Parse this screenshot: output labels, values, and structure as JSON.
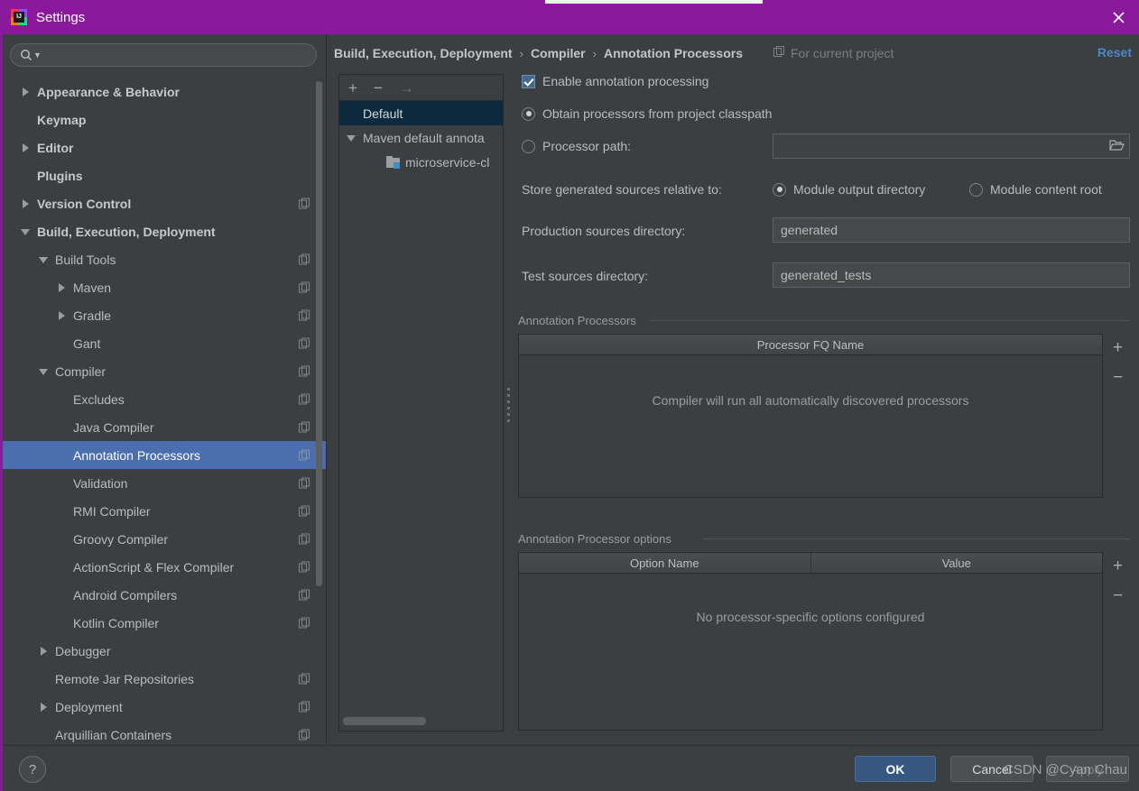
{
  "window": {
    "title": "Settings",
    "logo_icon": "intellij-idea-logo",
    "close_icon": "close-icon"
  },
  "sidebar": {
    "search": {
      "placeholder": "",
      "value": "",
      "icon": "search-icon",
      "dropdown_icon": "chevron-down-icon"
    },
    "items": [
      {
        "label": "Appearance & Behavior",
        "indent": 0,
        "twisty": "right",
        "bold": true,
        "copy": false,
        "selected": false
      },
      {
        "label": "Keymap",
        "indent": 0,
        "twisty": "none",
        "bold": true,
        "copy": false,
        "selected": false
      },
      {
        "label": "Editor",
        "indent": 0,
        "twisty": "right",
        "bold": true,
        "copy": false,
        "selected": false
      },
      {
        "label": "Plugins",
        "indent": 0,
        "twisty": "none",
        "bold": true,
        "copy": false,
        "selected": false
      },
      {
        "label": "Version Control",
        "indent": 0,
        "twisty": "right",
        "bold": true,
        "copy": true,
        "selected": false
      },
      {
        "label": "Build, Execution, Deployment",
        "indent": 0,
        "twisty": "down",
        "bold": true,
        "copy": false,
        "selected": false
      },
      {
        "label": "Build Tools",
        "indent": 1,
        "twisty": "down",
        "bold": false,
        "copy": true,
        "selected": false
      },
      {
        "label": "Maven",
        "indent": 2,
        "twisty": "right",
        "bold": false,
        "copy": true,
        "selected": false
      },
      {
        "label": "Gradle",
        "indent": 2,
        "twisty": "right",
        "bold": false,
        "copy": true,
        "selected": false
      },
      {
        "label": "Gant",
        "indent": 2,
        "twisty": "none",
        "bold": false,
        "copy": true,
        "selected": false
      },
      {
        "label": "Compiler",
        "indent": 1,
        "twisty": "down",
        "bold": false,
        "copy": true,
        "selected": false
      },
      {
        "label": "Excludes",
        "indent": 2,
        "twisty": "none",
        "bold": false,
        "copy": true,
        "selected": false
      },
      {
        "label": "Java Compiler",
        "indent": 2,
        "twisty": "none",
        "bold": false,
        "copy": true,
        "selected": false
      },
      {
        "label": "Annotation Processors",
        "indent": 2,
        "twisty": "none",
        "bold": false,
        "copy": true,
        "selected": true
      },
      {
        "label": "Validation",
        "indent": 2,
        "twisty": "none",
        "bold": false,
        "copy": true,
        "selected": false
      },
      {
        "label": "RMI Compiler",
        "indent": 2,
        "twisty": "none",
        "bold": false,
        "copy": true,
        "selected": false
      },
      {
        "label": "Groovy Compiler",
        "indent": 2,
        "twisty": "none",
        "bold": false,
        "copy": true,
        "selected": false
      },
      {
        "label": "ActionScript & Flex Compiler",
        "indent": 2,
        "twisty": "none",
        "bold": false,
        "copy": true,
        "selected": false
      },
      {
        "label": "Android Compilers",
        "indent": 2,
        "twisty": "none",
        "bold": false,
        "copy": true,
        "selected": false
      },
      {
        "label": "Kotlin Compiler",
        "indent": 2,
        "twisty": "none",
        "bold": false,
        "copy": true,
        "selected": false
      },
      {
        "label": "Debugger",
        "indent": 1,
        "twisty": "right",
        "bold": false,
        "copy": false,
        "selected": false
      },
      {
        "label": "Remote Jar Repositories",
        "indent": 1,
        "twisty": "none",
        "bold": false,
        "copy": true,
        "selected": false
      },
      {
        "label": "Deployment",
        "indent": 1,
        "twisty": "right",
        "bold": false,
        "copy": true,
        "selected": false
      },
      {
        "label": "Arquillian Containers",
        "indent": 1,
        "twisty": "none",
        "bold": false,
        "copy": true,
        "selected": false
      }
    ]
  },
  "header": {
    "crumb1": "Build, Execution, Deployment",
    "crumb2": "Compiler",
    "crumb3": "Annotation Processors",
    "separator": "›",
    "for_current_project": "For current project",
    "project_icon": "copy-icon",
    "reset_label": "Reset"
  },
  "profiles": {
    "toolbar": {
      "add": "+",
      "remove": "−",
      "move": "→"
    },
    "items": [
      {
        "label": "Default",
        "indent": 0,
        "twisty": "none",
        "icon": "none",
        "selected": true
      },
      {
        "label": "Maven default annota",
        "indent": 0,
        "twisty": "down",
        "icon": "none",
        "selected": false
      },
      {
        "label": "microservice-cl",
        "indent": 1,
        "twisty": "none",
        "icon": "folder-module-icon",
        "selected": false
      }
    ]
  },
  "main": {
    "enable_annotation_processing": {
      "label": "Enable annotation processing",
      "checked": true
    },
    "obtain_from_classpath": {
      "label": "Obtain processors from project classpath",
      "checked": true
    },
    "processor_path": {
      "label": "Processor path:",
      "checked": false,
      "value": "",
      "browse_icon": "folder-open-icon"
    },
    "store_relative_label": "Store generated sources relative to:",
    "module_output_directory": {
      "label": "Module output directory",
      "checked": true
    },
    "module_content_root": {
      "label": "Module content root",
      "checked": false
    },
    "production_sources": {
      "label": "Production sources directory:",
      "value": "generated"
    },
    "test_sources": {
      "label": "Test sources directory:",
      "value": "generated_tests"
    },
    "processors_group": {
      "title": "Annotation Processors",
      "columns": [
        "Processor FQ Name"
      ],
      "rows": [],
      "empty_message": "Compiler will run all automatically discovered processors",
      "add_button": "+",
      "remove_button": "−"
    },
    "options_group": {
      "title": "Annotation Processor options",
      "columns": [
        "Option Name",
        "Value"
      ],
      "rows": [],
      "empty_message": "No processor-specific options configured",
      "add_button": "+",
      "remove_button": "−"
    }
  },
  "footer": {
    "help_label": "?",
    "ok_label": "OK",
    "cancel_label": "Cancel",
    "apply_label": "Apply"
  },
  "watermark": {
    "text": "CSDN @Cyan Chau"
  },
  "colors": {
    "titlebar": "#8a1a9b",
    "background": "#3c3f41",
    "selection": "#4b6eaf",
    "selection_inactive": "#0d293e",
    "link": "#4a88c7",
    "primary_button": "#365880"
  }
}
